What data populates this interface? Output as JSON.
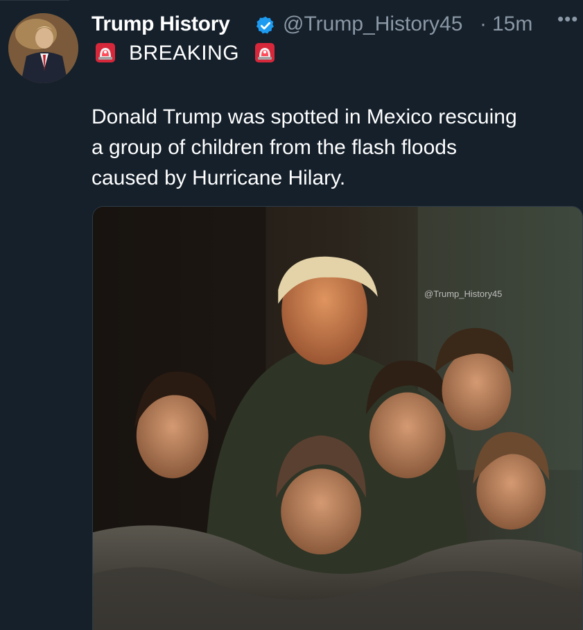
{
  "tweet": {
    "author": {
      "display_name": "Trump History",
      "handle": "@Trump_History45",
      "verified": true
    },
    "separator": "·",
    "timestamp": "15m",
    "more_label": "•••",
    "breaking_label": "BREAKING",
    "text_lines": [
      "Donald Trump was spotted in Mexico rescuing",
      "a group of children from the flash floods",
      "caused by Hurricane Hilary."
    ],
    "media": {
      "watermark": "@Trump_History45"
    }
  },
  "colors": {
    "background": "#15202b",
    "text_primary": "#ffffff",
    "text_secondary": "#8b98a5",
    "verified_blue": "#1d9bf0",
    "siren_red": "#e0245e"
  },
  "icons": {
    "verified": "verified-badge-icon",
    "siren": "police-siren-emoji-icon",
    "more": "more-options-icon"
  }
}
